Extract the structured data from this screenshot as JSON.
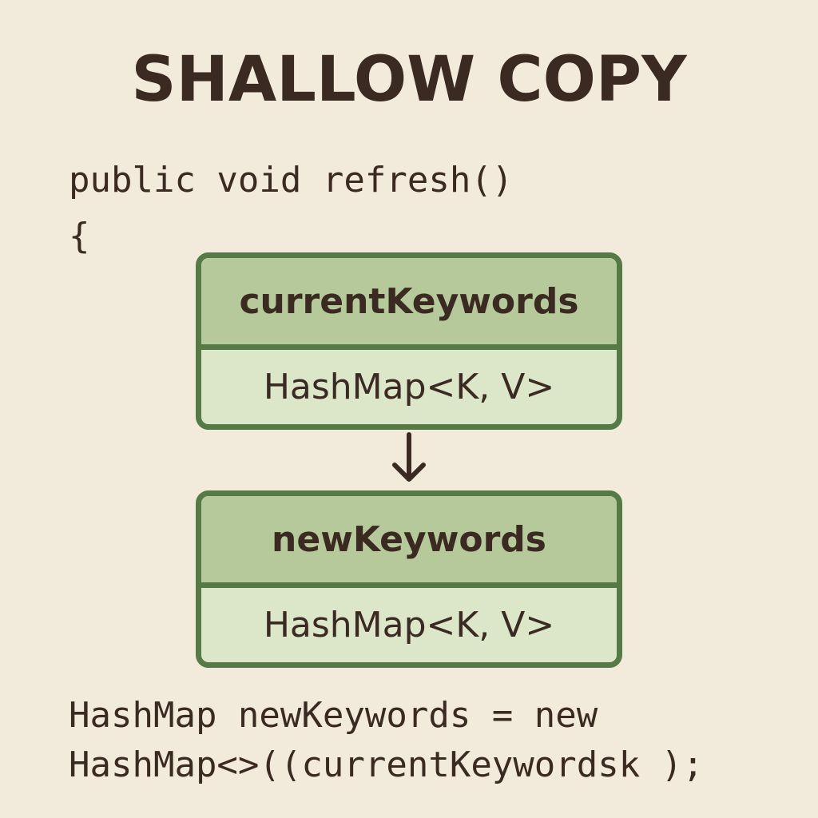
{
  "title": "SHALLOW COPY",
  "code": {
    "signature": "public void refresh()",
    "open_brace": "{",
    "statement_line1": "HashMap newKeywords = new",
    "statement_line2": "HashMap<>((currentKeywordsk );"
  },
  "boxes": [
    {
      "name": "currentKeywords",
      "type": "HashMap<K, V>"
    },
    {
      "name": "newKeywords",
      "type": "HashMap<K, V>"
    }
  ],
  "arrow_icon": "arrow-down-icon",
  "colors": {
    "background": "#f2eadb",
    "box_border": "#567a45",
    "box_header": "#b6c99b",
    "box_body": "#dce6c9",
    "text": "#3a2a22"
  }
}
